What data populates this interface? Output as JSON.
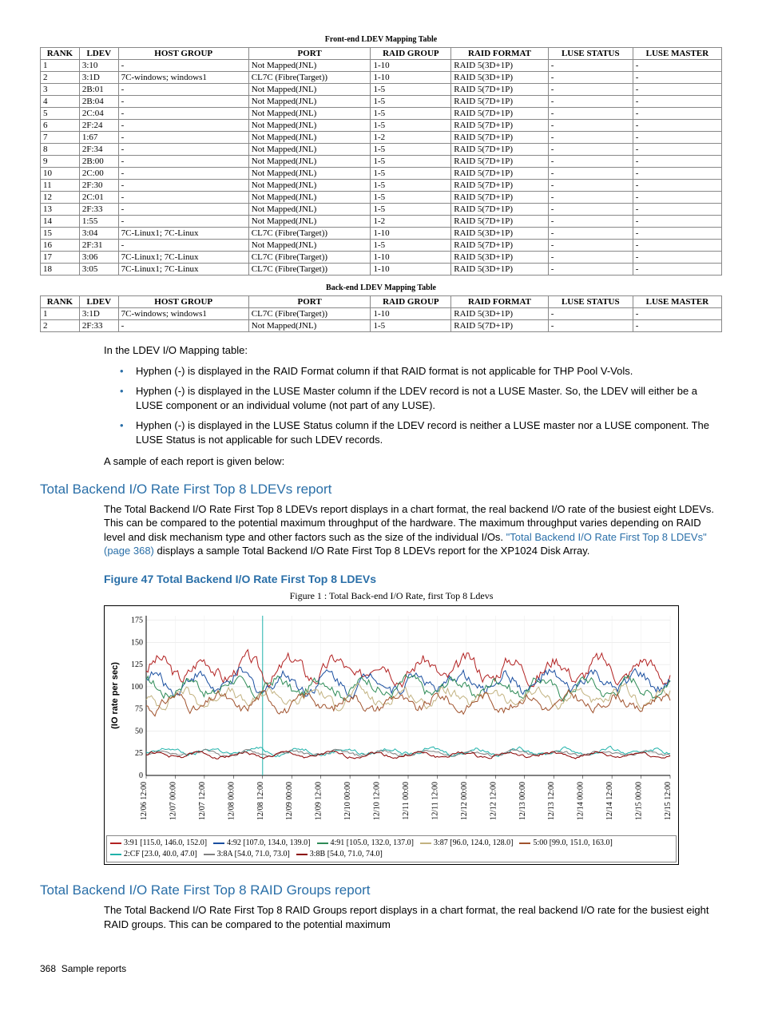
{
  "front_table": {
    "caption": "Front-end LDEV Mapping Table",
    "headers": [
      "RANK",
      "LDEV",
      "HOST GROUP",
      "PORT",
      "RAID GROUP",
      "RAID FORMAT",
      "LUSE STATUS",
      "LUSE MASTER"
    ],
    "rows": [
      [
        "1",
        "3:10",
        "-",
        "Not Mapped(JNL)",
        "1-10",
        "RAID 5(3D+1P)",
        "-",
        "-"
      ],
      [
        "2",
        "3:1D",
        "7C-windows; windows1",
        "CL7C (Fibre(Target))",
        "1-10",
        "RAID 5(3D+1P)",
        "-",
        "-"
      ],
      [
        "3",
        "2B:01",
        "-",
        "Not Mapped(JNL)",
        "1-5",
        "RAID 5(7D+1P)",
        "-",
        "-"
      ],
      [
        "4",
        "2B:04",
        "-",
        "Not Mapped(JNL)",
        "1-5",
        "RAID 5(7D+1P)",
        "-",
        "-"
      ],
      [
        "5",
        "2C:04",
        "-",
        "Not Mapped(JNL)",
        "1-5",
        "RAID 5(7D+1P)",
        "-",
        "-"
      ],
      [
        "6",
        "2F:24",
        "-",
        "Not Mapped(JNL)",
        "1-5",
        "RAID 5(7D+1P)",
        "-",
        "-"
      ],
      [
        "7",
        "1:67",
        "-",
        "Not Mapped(JNL)",
        "1-2",
        "RAID 5(7D+1P)",
        "-",
        "-"
      ],
      [
        "8",
        "2F:34",
        "-",
        "Not Mapped(JNL)",
        "1-5",
        "RAID 5(7D+1P)",
        "-",
        "-"
      ],
      [
        "9",
        "2B:00",
        "-",
        "Not Mapped(JNL)",
        "1-5",
        "RAID 5(7D+1P)",
        "-",
        "-"
      ],
      [
        "10",
        "2C:00",
        "-",
        "Not Mapped(JNL)",
        "1-5",
        "RAID 5(7D+1P)",
        "-",
        "-"
      ],
      [
        "11",
        "2F:30",
        "-",
        "Not Mapped(JNL)",
        "1-5",
        "RAID 5(7D+1P)",
        "-",
        "-"
      ],
      [
        "12",
        "2C:01",
        "-",
        "Not Mapped(JNL)",
        "1-5",
        "RAID 5(7D+1P)",
        "-",
        "-"
      ],
      [
        "13",
        "2F:33",
        "-",
        "Not Mapped(JNL)",
        "1-5",
        "RAID 5(7D+1P)",
        "-",
        "-"
      ],
      [
        "14",
        "1:55",
        "-",
        "Not Mapped(JNL)",
        "1-2",
        "RAID 5(7D+1P)",
        "-",
        "-"
      ],
      [
        "15",
        "3:04",
        "7C-Linux1; 7C-Linux",
        "CL7C (Fibre(Target))",
        "1-10",
        "RAID 5(3D+1P)",
        "-",
        "-"
      ],
      [
        "16",
        "2F:31",
        "-",
        "Not Mapped(JNL)",
        "1-5",
        "RAID 5(7D+1P)",
        "-",
        "-"
      ],
      [
        "17",
        "3:06",
        "7C-Linux1; 7C-Linux",
        "CL7C (Fibre(Target))",
        "1-10",
        "RAID 5(3D+1P)",
        "-",
        "-"
      ],
      [
        "18",
        "3:05",
        "7C-Linux1; 7C-Linux",
        "CL7C (Fibre(Target))",
        "1-10",
        "RAID 5(3D+1P)",
        "-",
        "-"
      ]
    ]
  },
  "back_table": {
    "caption": "Back-end LDEV Mapping Table",
    "headers": [
      "RANK",
      "LDEV",
      "HOST GROUP",
      "PORT",
      "RAID GROUP",
      "RAID FORMAT",
      "LUSE STATUS",
      "LUSE MASTER"
    ],
    "rows": [
      [
        "1",
        "3:1D",
        "7C-windows; windows1",
        "CL7C (Fibre(Target))",
        "1-10",
        "RAID 5(3D+1P)",
        "-",
        "-"
      ],
      [
        "2",
        "2F:33",
        "-",
        "Not Mapped(JNL)",
        "1-5",
        "RAID 5(7D+1P)",
        "-",
        "-"
      ]
    ]
  },
  "intro_text": "In the LDEV I/O Mapping table:",
  "bullets": [
    "Hyphen (-) is displayed in the RAID Format column if that RAID format is not applicable for THP Pool V-Vols.",
    "Hyphen (-) is displayed in the LUSE Master column if the LDEV record is not a LUSE Master. So, the LDEV will either be a LUSE component or an individual volume (not part of any LUSE).",
    "Hyphen (-) is displayed in the LUSE Status column if the LDEV record is neither a LUSE master nor a LUSE component. The LUSE Status is not applicable for such LDEV records."
  ],
  "sample_line": "A sample of each report is given below:",
  "section1": {
    "title": "Total Backend I/O Rate First Top 8 LDEVs report",
    "para_pre": "The Total Backend I/O Rate First Top 8 LDEVs report displays in a chart format, the real backend I/O rate of the busiest eight LDEVs. This can be compared to the potential maximum throughput of the hardware. The maximum throughput varies depending on RAID level and disk mechanism type and other factors such as the size of the individual I/Os. ",
    "link": "\"Total Backend I/O Rate First Top 8 LDEVs\" (page 368)",
    "para_post": " displays a sample Total Backend I/O Rate First Top 8 LDEVs report for the XP1024 Disk Array.",
    "figcap": "Figure 47 Total Backend I/O Rate First Top 8 LDEVs"
  },
  "section2": {
    "title": "Total Backend I/O Rate First Top 8 RAID Groups report",
    "para": "The Total Backend I/O Rate First Top 8 RAID Groups report displays in a chart format, the real backend I/O rate for the busiest eight RAID groups. This can be compared to the potential maximum"
  },
  "footer": {
    "page": "368",
    "label": "Sample reports"
  },
  "chart_data": {
    "type": "line",
    "title": "Figure 1 : Total Back-end I/O Rate, first Top 8 Ldevs",
    "ylabel": "(IO rate per sec)",
    "ylim": [
      0,
      180
    ],
    "yticks": [
      0,
      25,
      50,
      75,
      100,
      125,
      150,
      175
    ],
    "xticks": [
      "12/06 12:00",
      "12/07 00:00",
      "12/07 12:00",
      "12/08 00:00",
      "12/08 12:00",
      "12/09 00:00",
      "12/09 12:00",
      "12/10 00:00",
      "12/10 12:00",
      "12/11 00:00",
      "12/11 12:00",
      "12/12 00:00",
      "12/12 12:00",
      "12/13 00:00",
      "12/13 12:00",
      "12/14 00:00",
      "12/14 12:00",
      "12/15 00:00",
      "12/15 12:00"
    ],
    "legend": [
      {
        "name": "3:91 [115.0, 146.0, 152.0]",
        "color": "#b22222",
        "base": 120,
        "amp": 35
      },
      {
        "name": "4:92 [107.0, 134.0, 139.0]",
        "color": "#1a4fa0",
        "base": 105,
        "amp": 30
      },
      {
        "name": "4:91 [105.0, 132.0, 137.0]",
        "color": "#2e8b57",
        "base": 100,
        "amp": 28
      },
      {
        "name": "3:87 [96.0, 124.0, 128.0]",
        "color": "#c2b280",
        "base": 88,
        "amp": 26
      },
      {
        "name": "5:00 [99.0, 151.0, 163.0]",
        "color": "#a0522d",
        "base": 82,
        "amp": 26
      },
      {
        "name": "2:CF [23.0, 40.0, 47.0]",
        "color": "#20b2aa",
        "base": 27,
        "amp": 10
      },
      {
        "name": "3:8A [54.0, 71.0, 73.0]",
        "color": "#808080",
        "base": 25,
        "amp": 8
      },
      {
        "name": "3:8B [54.0, 71.0, 74.0]",
        "color": "#8b0000",
        "base": 23,
        "amp": 8
      }
    ]
  }
}
